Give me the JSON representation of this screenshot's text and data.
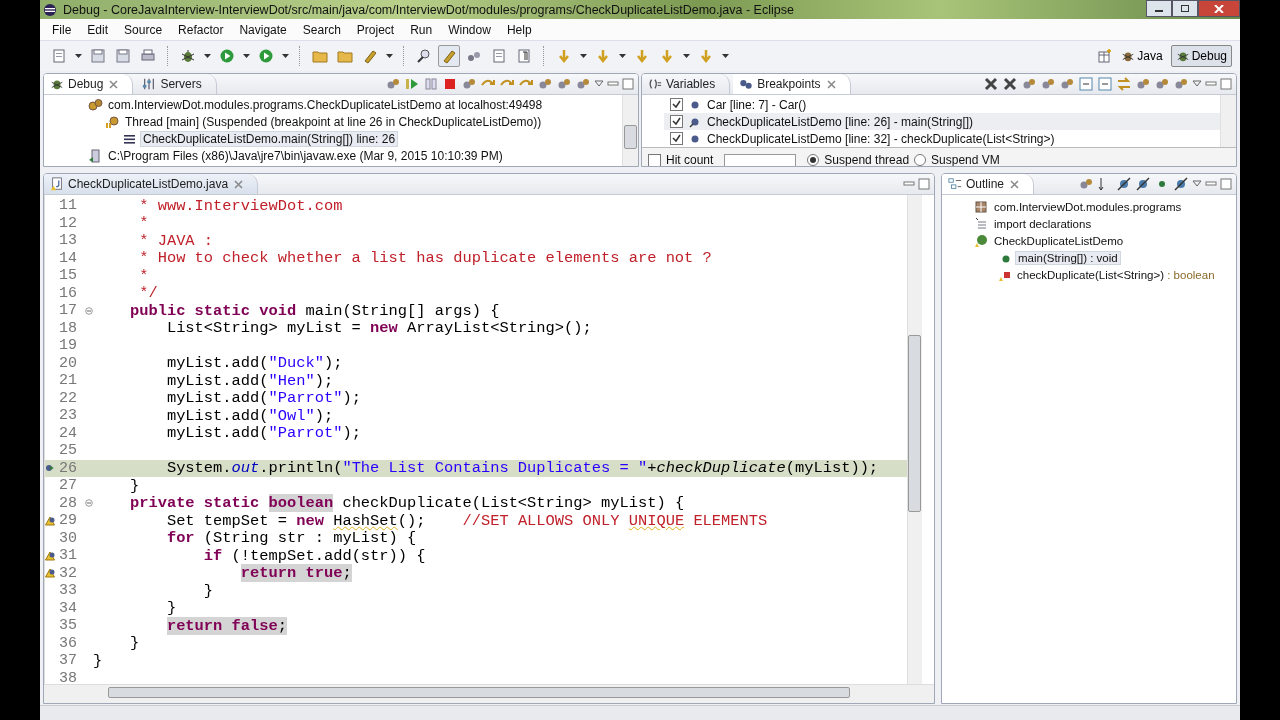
{
  "window": {
    "title": "Debug - CoreJavaInterview-InterviewDot/src/main/java/com/InterviewDot/modules/programs/CheckDuplicateListDemo.java - Eclipse"
  },
  "menu": [
    "File",
    "Edit",
    "Source",
    "Refactor",
    "Navigate",
    "Search",
    "Project",
    "Run",
    "Window",
    "Help"
  ],
  "perspectives": [
    {
      "label": "Java",
      "selected": false
    },
    {
      "label": "Debug",
      "selected": true
    }
  ],
  "debug_view": {
    "tabs": [
      {
        "label": "Debug",
        "selected": true
      },
      {
        "label": "Servers",
        "selected": false
      }
    ],
    "tree": [
      {
        "kind": "target",
        "label": "com.InterviewDot.modules.programs.CheckDuplicateListDemo at localhost:49498",
        "selected": false,
        "children": [
          {
            "kind": "thread",
            "label": "Thread [main] (Suspended (breakpoint at line 26 in CheckDuplicateListDemo))",
            "selected": false,
            "children": [
              {
                "kind": "frame",
                "label": "CheckDuplicateListDemo.main(String[]) line: 26",
                "selected": true
              }
            ]
          }
        ]
      },
      {
        "kind": "process",
        "label": "C:\\Program Files (x86)\\Java\\jre7\\bin\\javaw.exe (Mar 9, 2015 10:10:39 PM)",
        "selected": false
      }
    ]
  },
  "breakpoints_view": {
    "tabs": [
      {
        "label": "Variables",
        "selected": false
      },
      {
        "label": "Breakpoints",
        "selected": true
      }
    ],
    "items": [
      {
        "label": "Car [line: 7] - Car()",
        "checked": true,
        "selected": false
      },
      {
        "label": "CheckDuplicateListDemo [line: 26] - main(String[])",
        "checked": true,
        "selected": true
      },
      {
        "label": "CheckDuplicateListDemo [line: 32] - checkDuplicate(List<String>)",
        "checked": true,
        "selected": false
      }
    ],
    "hit_count": {
      "label": "Hit count",
      "checked": false
    },
    "suspend": [
      {
        "label": "Suspend thread",
        "selected": true
      },
      {
        "label": "Suspend VM",
        "selected": false
      }
    ]
  },
  "editor": {
    "tab": {
      "label": "CheckDuplicateListDemo.java",
      "selected": true
    },
    "lines": [
      {
        "number": "11",
        "tokens": [
          {
            "t": "     * www.InterviewDot.com",
            "kind": "comment"
          }
        ]
      },
      {
        "number": "12",
        "tokens": [
          {
            "t": "     *",
            "kind": "comment"
          }
        ]
      },
      {
        "number": "13",
        "tokens": [
          {
            "t": "     * JAVA :",
            "kind": "comment"
          }
        ]
      },
      {
        "number": "14",
        "tokens": [
          {
            "t": "     * How to check whether a list has duplicate elements are not ?",
            "kind": "comment"
          }
        ]
      },
      {
        "number": "15",
        "tokens": [
          {
            "t": "     *",
            "kind": "comment"
          }
        ]
      },
      {
        "number": "16",
        "tokens": [
          {
            "t": "     */",
            "kind": "comment"
          }
        ]
      },
      {
        "number": "17",
        "fold": true,
        "tokens": [
          {
            "t": "    public",
            "kind": "keyword"
          },
          {
            "t": " static",
            "kind": "keyword"
          },
          {
            "t": " void",
            "kind": "keyword"
          },
          {
            "t": " main(String[] args) {",
            "kind": "plain"
          }
        ]
      },
      {
        "number": "18",
        "tokens": [
          {
            "t": "        List<String> myList = ",
            "kind": "plain"
          },
          {
            "t": "new",
            "kind": "keyword"
          },
          {
            "t": " ArrayList<String>();",
            "kind": "plain"
          }
        ]
      },
      {
        "number": "19"
      },
      {
        "number": "20",
        "tokens": [
          {
            "t": "        myList.add(",
            "kind": "plain"
          },
          {
            "t": "\"Duck\"",
            "kind": "string"
          },
          {
            "t": ");",
            "kind": "plain"
          }
        ]
      },
      {
        "number": "21",
        "tokens": [
          {
            "t": "        myList.add(",
            "kind": "plain"
          },
          {
            "t": "\"Hen\"",
            "kind": "string"
          },
          {
            "t": ");",
            "kind": "plain"
          }
        ]
      },
      {
        "number": "22",
        "tokens": [
          {
            "t": "        myList.add(",
            "kind": "plain"
          },
          {
            "t": "\"Parrot\"",
            "kind": "string"
          },
          {
            "t": ");",
            "kind": "plain"
          }
        ]
      },
      {
        "number": "23",
        "tokens": [
          {
            "t": "        myList.add(",
            "kind": "plain"
          },
          {
            "t": "\"Owl\"",
            "kind": "string"
          },
          {
            "t": ");",
            "kind": "plain"
          }
        ]
      },
      {
        "number": "24",
        "tokens": [
          {
            "t": "        myList.add(",
            "kind": "plain"
          },
          {
            "t": "\"Parrot\"",
            "kind": "string"
          },
          {
            "t": ");",
            "kind": "plain"
          }
        ]
      },
      {
        "number": "25"
      },
      {
        "number": "26",
        "current": true,
        "kind": "instruction-pointer",
        "tokens": [
          {
            "t": "        System.",
            "kind": "plain"
          },
          {
            "t": "out",
            "kind": "field"
          },
          {
            "t": ".println(",
            "kind": "plain"
          },
          {
            "t": "\"The List Contains Duplicates = \"",
            "kind": "string"
          },
          {
            "t": "+",
            "kind": "plain"
          },
          {
            "t": "checkDuplicate",
            "kind": "static-call"
          },
          {
            "t": "(myList));",
            "kind": "plain"
          }
        ]
      },
      {
        "number": "27",
        "tokens": [
          {
            "t": "    }",
            "kind": "plain"
          }
        ]
      },
      {
        "number": "28",
        "fold": true,
        "tokens": [
          {
            "t": "    private",
            "kind": "keyword"
          },
          {
            "t": " static ",
            "kind": "keyword"
          },
          {
            "t": "boolean",
            "kind": "keyword",
            "highlight": true
          },
          {
            "t": " checkDuplicate(List<String> myList) {",
            "kind": "plain"
          }
        ]
      },
      {
        "number": "29",
        "kind": "warning",
        "tokens": [
          {
            "t": "        Set tempSet = ",
            "kind": "plain"
          },
          {
            "t": "new ",
            "kind": "keyword"
          },
          {
            "t": "HashSet",
            "kind": "plain",
            "warn": true
          },
          {
            "t": "();    ",
            "kind": "plain"
          },
          {
            "t": "//SET ALLOWS ONLY ",
            "kind": "comment"
          },
          {
            "t": "UNIQUE",
            "kind": "comment",
            "warn": true
          },
          {
            "t": " ELEMENTS",
            "kind": "comment"
          }
        ]
      },
      {
        "number": "30",
        "tokens": [
          {
            "t": "        for",
            "kind": "keyword"
          },
          {
            "t": " (String str : myList) {",
            "kind": "plain"
          }
        ]
      },
      {
        "number": "31",
        "kind": "warning",
        "tokens": [
          {
            "t": "            if",
            "kind": "keyword"
          },
          {
            "t": " (!tempSet.add(str)) {",
            "kind": "plain"
          }
        ]
      },
      {
        "number": "32",
        "kind": "warning",
        "tokens": [
          {
            "t": "                return",
            "kind": "keyword",
            "highlight": true
          },
          {
            "t": " true",
            "kind": "keyword",
            "highlight": true
          },
          {
            "t": ";",
            "kind": "plain",
            "highlight": true
          }
        ]
      },
      {
        "number": "33",
        "tokens": [
          {
            "t": "            }",
            "kind": "plain"
          }
        ]
      },
      {
        "number": "34",
        "tokens": [
          {
            "t": "        }",
            "kind": "plain"
          }
        ]
      },
      {
        "number": "35",
        "tokens": [
          {
            "t": "        return",
            "kind": "keyword",
            "highlight": true
          },
          {
            "t": " false",
            "kind": "keyword",
            "highlight": true
          },
          {
            "t": ";",
            "kind": "plain",
            "highlight": true
          }
        ]
      },
      {
        "number": "36",
        "tokens": [
          {
            "t": "    }",
            "kind": "plain"
          }
        ]
      },
      {
        "number": "37",
        "tokens": [
          {
            "t": "}",
            "kind": "plain"
          }
        ]
      },
      {
        "number": "38"
      }
    ]
  },
  "outline": {
    "tab": {
      "label": "Outline",
      "selected": true
    },
    "tree": [
      {
        "kind": "package",
        "label": "com.InterviewDot.modules.programs",
        "selected": false
      },
      {
        "kind": "imports",
        "label": "import declarations",
        "selected": false
      },
      {
        "kind": "class",
        "label": "CheckDuplicateListDemo",
        "selected": false,
        "children": [
          {
            "kind": "public-method",
            "label": "main(String[]) : void",
            "selected": true
          },
          {
            "kind": "private-method",
            "label": "checkDuplicate(List<String>)",
            "type": " : boolean",
            "selected": false
          }
        ]
      }
    ]
  }
}
